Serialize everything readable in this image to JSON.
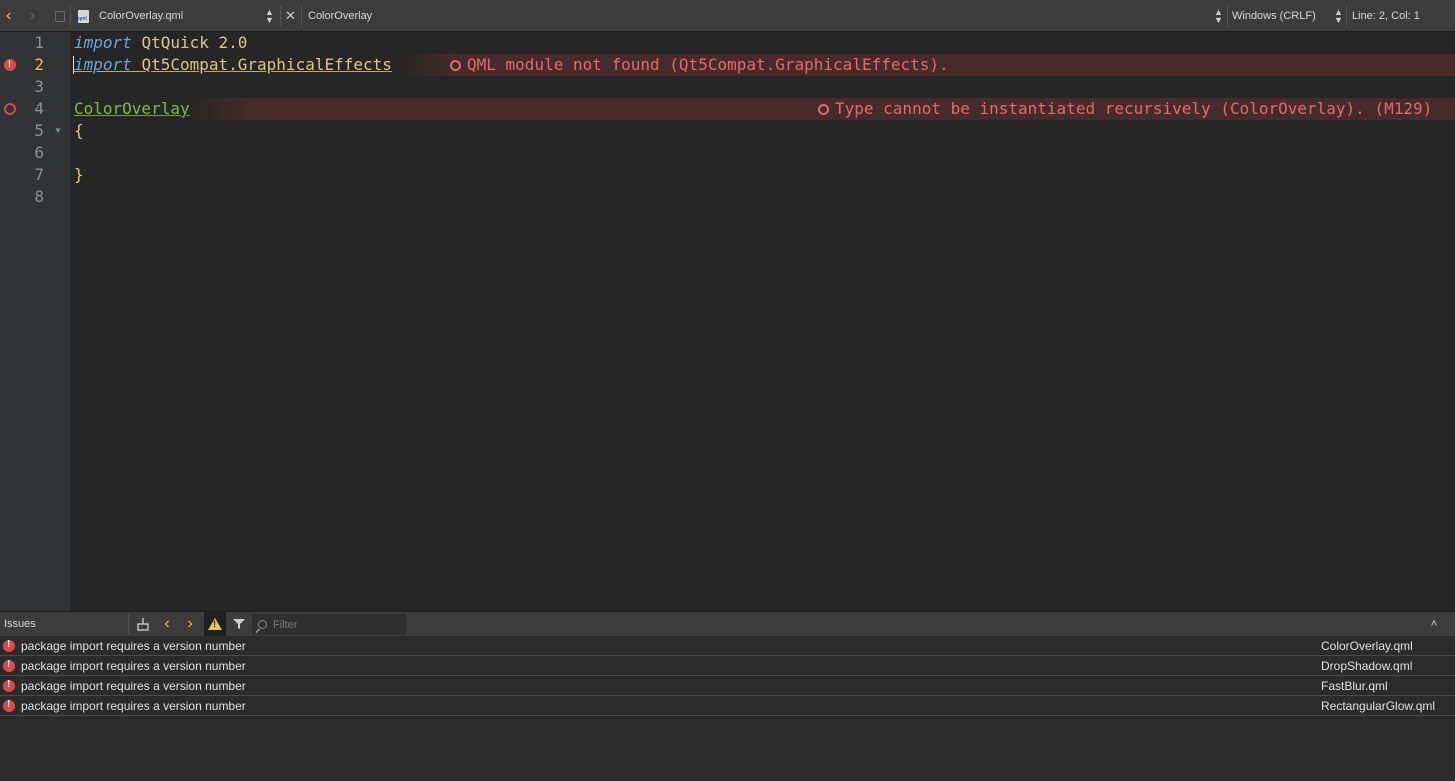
{
  "toolbar": {
    "back_icon": "chevron-left-icon",
    "forward_icon": "chevron-right-icon",
    "file_name": "ColorOverlay.qml",
    "symbol": "ColorOverlay",
    "line_endings": "Windows (CRLF)",
    "cursor_position": "Line: 2, Col: 1"
  },
  "editor": {
    "lines": [
      {
        "number": "1",
        "tokens": [
          "import",
          "QtQuick 2.0"
        ]
      },
      {
        "number": "2",
        "tokens": [
          "import",
          "Qt5Compat.GraphicalEffects"
        ]
      },
      {
        "number": "3",
        "tokens": []
      },
      {
        "number": "4",
        "tokens": [
          "ColorOverlay"
        ]
      },
      {
        "number": "5",
        "tokens": [
          "{"
        ]
      },
      {
        "number": "6",
        "tokens": []
      },
      {
        "number": "7",
        "tokens": [
          "}"
        ]
      },
      {
        "number": "8",
        "tokens": []
      }
    ],
    "current_line": "2",
    "diagnostics": [
      {
        "line": "2",
        "message": "QML module not found (Qt5Compat.GraphicalEffects)."
      },
      {
        "line": "4",
        "message": "Type cannot be instantiated recursively (ColorOverlay). (M129)"
      }
    ]
  },
  "issues": {
    "title": "Issues",
    "filter_placeholder": "Filter",
    "items": [
      {
        "message": "package import requires a version number",
        "file": "ColorOverlay.qml"
      },
      {
        "message": "package import requires a version number",
        "file": "DropShadow.qml"
      },
      {
        "message": "package import requires a version number",
        "file": "FastBlur.qml"
      },
      {
        "message": "package import requires a version number",
        "file": "RectangularGlow.qml"
      }
    ]
  },
  "colors": {
    "error": "#d94a4a",
    "current_line_number": "#e7c54b",
    "keyword": "#6aa7d8",
    "type": "#8ab44a"
  }
}
